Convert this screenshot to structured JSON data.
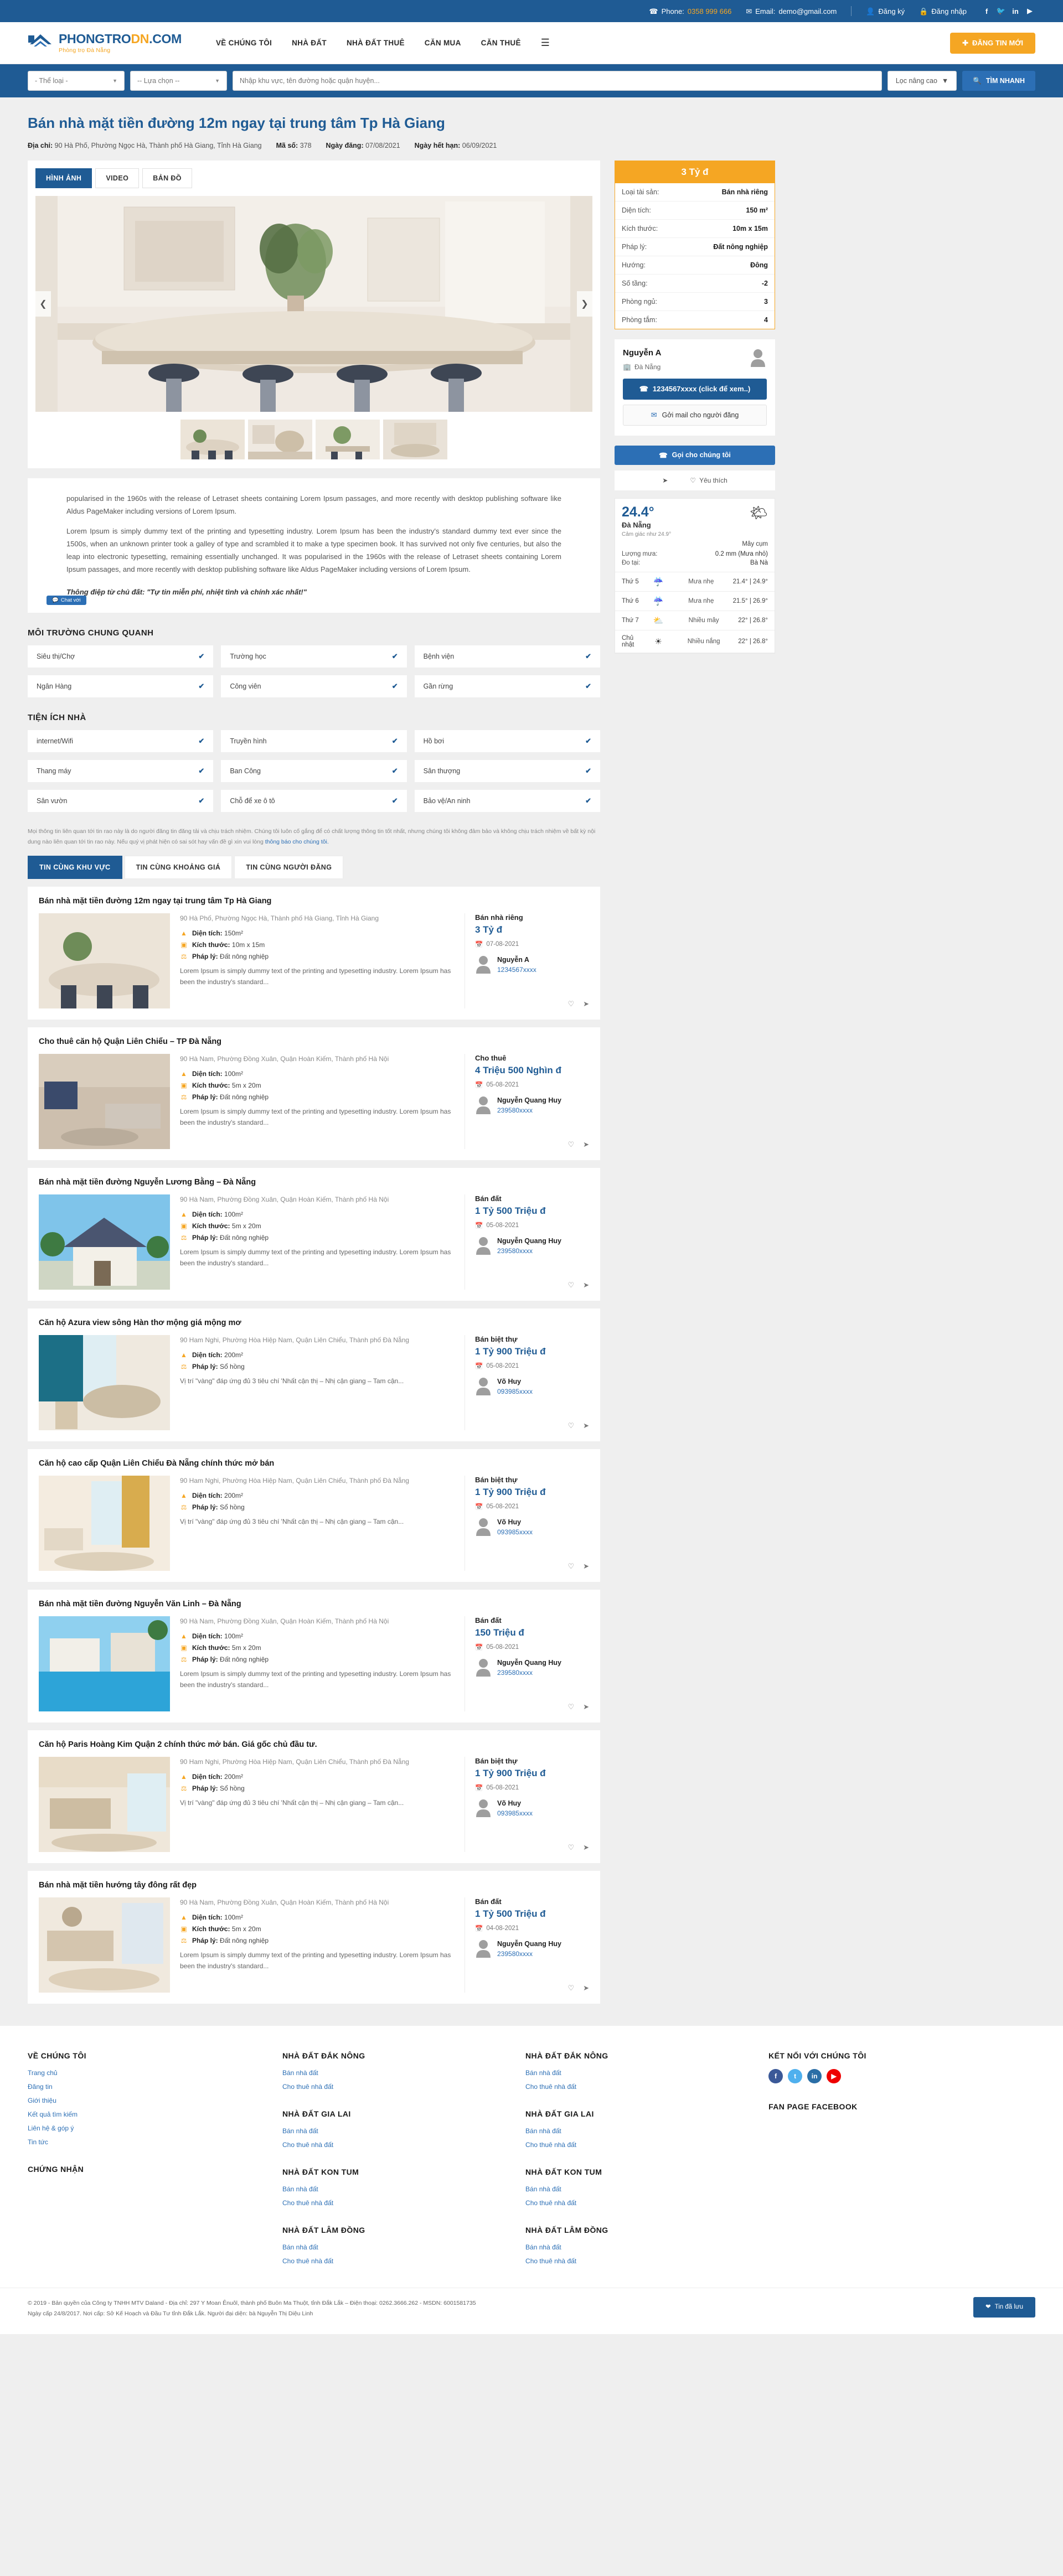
{
  "topbar": {
    "phone_label": "Phone:",
    "phone": "0358 999 666",
    "email_label": "Email:",
    "email": "demo@gmail.com",
    "register": "Đăng ký",
    "login": "Đăng nhập",
    "socials": [
      "facebook",
      "twitter",
      "linkedin",
      "youtube"
    ]
  },
  "header": {
    "logo_main_1": "PHONGTRO",
    "logo_main_2": "DN",
    "logo_main_3": ".COM",
    "logo_sub": "Phòng trọ Đà Nẵng",
    "nav": [
      "VỀ CHÚNG TÔI",
      "NHÀ ĐẤT",
      "NHÀ ĐẤT THUÊ",
      "CĂN MUA",
      "CĂN THUÊ"
    ],
    "post_button": "ĐĂNG TIN MỚI"
  },
  "search": {
    "category": "- Thể loại -",
    "option": "-- Lựa chọn --",
    "keyword_placeholder": "Nhập khu vực, tên đường hoặc quận huyện...",
    "advanced": "Lọc nâng cao",
    "submit": "TÌM NHANH"
  },
  "listing_detail": {
    "title": "Bán nhà mặt tiền đường 12m ngay tại trung tâm Tp Hà Giang",
    "address_label": "Địa chỉ:",
    "address": "90 Hà Phố, Phường Ngọc Hà, Thành phố Hà Giang, Tỉnh Hà Giang",
    "code_label": "Mã số:",
    "code": "378",
    "posted_label": "Ngày đăng:",
    "posted": "07/08/2021",
    "expire_label": "Ngày hết hạn:",
    "expire": "06/09/2021",
    "media_tabs": [
      "HÌNH ẢNH",
      "VIDEO",
      "BẢN ĐỒ"
    ],
    "description": [
      "popularised in the 1960s with the release of Letraset sheets containing Lorem Ipsum passages, and more recently with desktop publishing software like Aldus PageMaker including versions of Lorem Ipsum.",
      "Lorem Ipsum is simply dummy text of the printing and typesetting industry. Lorem Ipsum has been the industry's standard dummy text ever since the 1500s, when an unknown printer took a galley of type and scrambled it to make a type specimen book. It has survived not only five centuries, but also the leap into electronic typesetting, remaining essentially unchanged. It was popularised in the 1960s with the release of Letraset sheets containing Lorem Ipsum passages, and more recently with desktop publishing software like Aldus PageMaker including versions of Lorem Ipsum."
    ],
    "quote_label": "Thông điệp từ chủ đất:",
    "quote_value": "\"Tự tin miễn phí, nhiệt tình và chính xác nhất!\"",
    "chat_chip": "Chat với"
  },
  "price_card": {
    "price": "3 Tỷ đ",
    "rows": [
      {
        "key": "Loại tài sản:",
        "value": "Bán nhà riêng"
      },
      {
        "key": "Diện tích:",
        "value": "150 m²"
      },
      {
        "key": "Kích thước:",
        "value": "10m x 15m"
      },
      {
        "key": "Pháp lý:",
        "value": "Đất nông nghiệp"
      },
      {
        "key": "Hướng:",
        "value": "Đông"
      },
      {
        "key": "Số tầng:",
        "value": "-2"
      },
      {
        "key": "Phòng ngủ:",
        "value": "3"
      },
      {
        "key": "Phòng tắm:",
        "value": "4"
      }
    ]
  },
  "contact": {
    "name": "Nguyễn A",
    "location": "Đà Nẵng",
    "phone_button": "1234567xxxx (click để xem..)",
    "mail_button": "Gởi mail cho người đăng",
    "report_button": "Gọi cho chúng tôi",
    "share_label": "",
    "favorite_label": "Yêu thích"
  },
  "weather": {
    "temp": "24.4°",
    "city": "Đà Nẵng",
    "feels": "Cảm giác như 24.9°",
    "condition": "Mây cụm",
    "rain_label": "Lượng mưa:",
    "rain_value": "0.2 mm (Mưa nhỏ)",
    "station_label": "Đo tại:",
    "station_value": "Bà Nà",
    "forecast": [
      {
        "day": "Thứ 5",
        "icon": "☔",
        "desc": "Mưa nhẹ",
        "temp": "21.4° | 24.9°"
      },
      {
        "day": "Thứ 6",
        "icon": "☔",
        "desc": "Mưa nhẹ",
        "temp": "21.5° | 26.9°"
      },
      {
        "day": "Thứ 7",
        "icon": "⛅",
        "desc": "Nhiều mây",
        "temp": "22° | 26.8°"
      },
      {
        "day": "Chủ nhật",
        "icon": "☀",
        "desc": "Nhiều nắng",
        "temp": "22° | 26.8°"
      }
    ]
  },
  "environment": {
    "title": "MÔI TRƯỜNG CHUNG QUANH",
    "items": [
      "Siêu thị/Chợ",
      "Trường học",
      "Bệnh viện",
      "Ngân Hàng",
      "Công viên",
      "Gần rừng"
    ]
  },
  "amenities": {
    "title": "TIỆN ÍCH NHÀ",
    "items": [
      "internet/Wifi",
      "Truyền hình",
      "Hồ bơi",
      "Thang máy",
      "Ban Công",
      "Sân thượng",
      "Sân vườn",
      "Chỗ để xe ô tô",
      "Bảo vệ/An ninh"
    ]
  },
  "disclaimer": {
    "text": "Mọi thông tin liên quan tới tin rao này là do người đăng tin đăng tải và chịu trách nhiệm. Chúng tôi luôn cố gắng để có chất lượng thông tin tốt nhất, nhưng chúng tôi không đảm bảo và không chịu trách nhiệm về bất kỳ nội dung nào liên quan tới tin rao này. Nếu quý vị phát hiện có sai sót hay vấn đề gì xin vui lòng",
    "link": "thông báo cho chúng tôi."
  },
  "related": {
    "tabs": [
      "TIN CÙNG KHU VỰC",
      "TIN CÙNG KHOẢNG GIÁ",
      "TIN CÙNG NGƯỜI ĐĂNG"
    ],
    "labels": {
      "area": "Diện tích:",
      "size": "Kích thước:",
      "legal": "Pháp lý:"
    },
    "items": [
      {
        "title": "Bán nhà mặt tiền đường 12m ngay tại trung tâm Tp Hà Giang",
        "address": "90 Hà Phố, Phường Ngọc Hà, Thành phố Hà Giang, Tỉnh Hà Giang",
        "area": "150m²",
        "size": "10m x 15m",
        "legal": "Đất nông nghiệp",
        "excerpt": "Lorem Ipsum is simply dummy text of the printing and typesetting industry. Lorem Ipsum has been the industry's standard...",
        "type": "Bán nhà riêng",
        "price": "3 Tỷ đ",
        "date": "07-08-2021",
        "user": "Nguyễn A",
        "phone": "1234567xxxx",
        "img": "kitchen"
      },
      {
        "title": "Cho thuê căn hộ Quận Liên Chiểu – TP Đà Nẵng",
        "address": "90 Hà Nam, Phường Đồng Xuân, Quận Hoàn Kiếm, Thành phố Hà Nội",
        "area": "100m²",
        "size": "5m x 20m",
        "legal": "Đất nông nghiệp",
        "excerpt": "Lorem Ipsum is simply dummy text of the printing and typesetting industry. Lorem Ipsum has been the industry's standard...",
        "type": "Cho thuê",
        "price": "4 Triệu 500 Nghìn đ",
        "date": "05-08-2021",
        "user": "Nguyễn Quang Huy",
        "phone": "239580xxxx",
        "img": "livingroom"
      },
      {
        "title": "Bán nhà mặt tiền đường Nguyễn Lương Bằng – Đà Nẵng",
        "address": "90 Hà Nam, Phường Đồng Xuân, Quận Hoàn Kiếm, Thành phố Hà Nội",
        "area": "100m²",
        "size": "5m x 20m",
        "legal": "Đất nông nghiệp",
        "excerpt": "Lorem Ipsum is simply dummy text of the printing and typesetting industry. Lorem Ipsum has been the industry's standard...",
        "type": "Bán đất",
        "price": "1 Tỷ 500 Triệu đ",
        "date": "05-08-2021",
        "user": "Nguyễn Quang Huy",
        "phone": "239580xxxx",
        "img": "villa"
      },
      {
        "title": "Căn hộ Azura view sông Hàn thơ mộng giá mộng mơ",
        "address": "90 Ham Nghi, Phường Hòa Hiệp Nam, Quận Liên Chiểu, Thành phố Đà Nẵng",
        "area": "200m²",
        "size": "",
        "legal": "Sổ hồng",
        "excerpt": "Vị trí \"vàng\" đáp ứng đủ 3 tiêu chí 'Nhất cận thị – Nhị cận giang – Tam cận...",
        "type": "Bán biệt thự",
        "price": "1 Tỷ 900 Triệu đ",
        "date": "05-08-2021",
        "user": "Võ Huy",
        "phone": "093985xxxx",
        "img": "apartment1"
      },
      {
        "title": "Căn hộ cao cấp Quận Liên Chiểu Đà Nẵng chính thức mở bán",
        "address": "90 Ham Nghi, Phường Hòa Hiệp Nam, Quận Liên Chiểu, Thành phố Đà Nẵng",
        "area": "200m²",
        "size": "",
        "legal": "Sổ hồng",
        "excerpt": "Vị trí \"vàng\" đáp ứng đủ 3 tiêu chí 'Nhất cận thị – Nhị cận giang – Tam cận...",
        "type": "Bán biệt thự",
        "price": "1 Tỷ 900 Triệu đ",
        "date": "05-08-2021",
        "user": "Võ Huy",
        "phone": "093985xxxx",
        "img": "apartment2"
      },
      {
        "title": "Bán nhà mặt tiền đường Nguyễn Văn Linh – Đà Nẵng",
        "address": "90 Hà Nam, Phường Đồng Xuân, Quận Hoàn Kiếm, Thành phố Hà Nội",
        "area": "100m²",
        "size": "5m x 20m",
        "legal": "Đất nông nghiệp",
        "excerpt": "Lorem Ipsum is simply dummy text of the printing and typesetting industry. Lorem Ipsum has been the industry's standard...",
        "type": "Bán đất",
        "price": "150 Triệu đ",
        "date": "05-08-2021",
        "user": "Nguyễn Quang Huy",
        "phone": "239580xxxx",
        "img": "pool"
      },
      {
        "title": "Căn hộ Paris Hoàng Kim Quận 2 chính thức mở bán. Giá gốc chủ đầu tư.",
        "address": "90 Ham Nghi, Phường Hòa Hiệp Nam, Quận Liên Chiểu, Thành phố Đà Nẵng",
        "area": "200m²",
        "size": "",
        "legal": "Sổ hồng",
        "excerpt": "Vị trí \"vàng\" đáp ứng đủ 3 tiêu chí 'Nhất cận thị – Nhị cận giang – Tam cận...",
        "type": "Bán biệt thự",
        "price": "1 Tỷ 900 Triệu đ",
        "date": "05-08-2021",
        "user": "Võ Huy",
        "phone": "093985xxxx",
        "img": "apartment3"
      },
      {
        "title": "Bán nhà mặt tiền hướng tây đông rất đẹp",
        "address": "90 Hà Nam, Phường Đồng Xuân, Quận Hoàn Kiếm, Thành phố Hà Nội",
        "area": "100m²",
        "size": "5m x 20m",
        "legal": "Đất nông nghiệp",
        "excerpt": "Lorem Ipsum is simply dummy text of the printing and typesetting industry. Lorem Ipsum has been the industry's standard...",
        "type": "Bán đất",
        "price": "1 Tỷ 500 Triệu đ",
        "date": "04-08-2021",
        "user": "Nguyễn Quang Huy",
        "phone": "239580xxxx",
        "img": "interior"
      }
    ]
  },
  "footer": {
    "col1_title": "VỀ CHÚNG TÔI",
    "col1_links": [
      "Trang chủ",
      "Đăng tin",
      "Giới thiệu",
      "Kết quả tìm kiếm",
      "Liên hệ & góp ý",
      "Tin tức"
    ],
    "col1_title2": "CHỨNG NHẬN",
    "col2_groups": [
      {
        "title": "NHÀ ĐẤT ĐẮK NÔNG",
        "links": [
          "Bán nhà đất",
          "Cho thuê nhà đất"
        ]
      },
      {
        "title": "NHÀ ĐẤT GIA LAI",
        "links": [
          "Bán nhà đất",
          "Cho thuê nhà đất"
        ]
      },
      {
        "title": "NHÀ ĐẤT KON TUM",
        "links": [
          "Bán nhà đất",
          "Cho thuê nhà đất"
        ]
      },
      {
        "title": "NHÀ ĐẤT LÂM ĐỒNG",
        "links": [
          "Bán nhà đất",
          "Cho thuê nhà đất"
        ]
      }
    ],
    "col3_groups": [
      {
        "title": "NHÀ ĐẤT ĐẮK NÔNG",
        "links": [
          "Bán nhà đất",
          "Cho thuê nhà đất"
        ]
      },
      {
        "title": "NHÀ ĐẤT GIA LAI",
        "links": [
          "Bán nhà đất",
          "Cho thuê nhà đất"
        ]
      },
      {
        "title": "NHÀ ĐẤT KON TUM",
        "links": [
          "Bán nhà đất",
          "Cho thuê nhà đất"
        ]
      },
      {
        "title": "NHÀ ĐẤT LÂM ĐỒNG",
        "links": [
          "Bán nhà đất",
          "Cho thuê nhà đất"
        ]
      }
    ],
    "col4_title": "KẾT NỐI VỚI CHÚNG TÔI",
    "col4_title2": "FAN PAGE FACEBOOK"
  },
  "copyright": {
    "line1": "© 2019 - Bản quyền của Công ty TNHH MTV Daland - Địa chỉ: 297 Y Moan Ênuôl, thành phố Buôn Ma Thuột, tỉnh Đắk Lắk – Điện thoại: 0262.3666.262 - MSDN: 6001581735",
    "line2": "Ngày cấp 24/8/2017. Nơi cấp: Sở Kế Hoạch và Đầu Tư tỉnh Đắk Lắk. Người đại diện: bà Nguyễn Thị Diệu Linh",
    "saved_button": "Tin đã lưu"
  },
  "colors": {
    "brand_blue": "#1f5b94",
    "brand_orange": "#f5a623",
    "link_blue": "#2c6fb5"
  }
}
